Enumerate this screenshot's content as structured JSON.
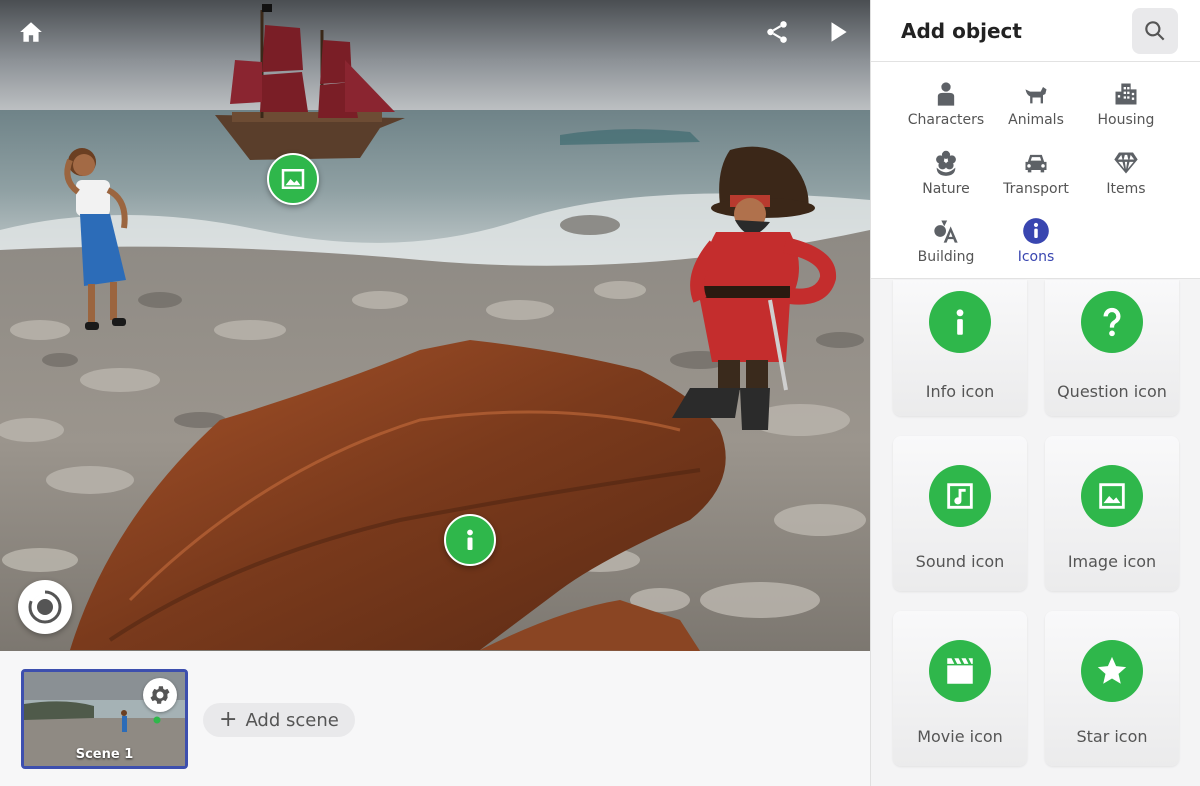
{
  "viewport": {
    "home_icon": "home-icon",
    "share_icon": "share-icon",
    "play_icon": "play-icon",
    "hotspots": [
      {
        "name": "image-hotspot",
        "icon": "image-icon",
        "color": "#2fb74b"
      },
      {
        "name": "info-hotspot",
        "icon": "info-icon",
        "color": "#2fb74b"
      }
    ],
    "gyro_icon": "gyroscope-icon"
  },
  "scene_strip": {
    "scenes": [
      {
        "label": "Scene 1",
        "selected": true
      }
    ],
    "add_scene_label": "Add scene",
    "add_scene_icon": "plus-icon"
  },
  "panel": {
    "title": "Add object",
    "search_icon": "search-icon",
    "categories": [
      {
        "label": "Characters",
        "icon": "person-icon",
        "active": false
      },
      {
        "label": "Animals",
        "icon": "dog-icon",
        "active": false
      },
      {
        "label": "Housing",
        "icon": "building-icon",
        "active": false
      },
      {
        "label": "Nature",
        "icon": "flower-icon",
        "active": false
      },
      {
        "label": "Transport",
        "icon": "car-icon",
        "active": false
      },
      {
        "label": "Items",
        "icon": "diamond-icon",
        "active": false
      },
      {
        "label": "Building",
        "icon": "shapes-icon",
        "active": false
      },
      {
        "label": "Icons",
        "icon": "info-icon",
        "active": true
      }
    ],
    "items": [
      {
        "label": "Info icon",
        "icon": "info-icon"
      },
      {
        "label": "Question icon",
        "icon": "question-icon"
      },
      {
        "label": "Sound icon",
        "icon": "music-note-icon"
      },
      {
        "label": "Image icon",
        "icon": "image-icon"
      },
      {
        "label": "Movie icon",
        "icon": "clapperboard-icon"
      },
      {
        "label": "Star icon",
        "icon": "star-icon"
      }
    ]
  },
  "colors": {
    "accent": "#3946b0",
    "hotspot_green": "#2fb74b",
    "selected_border": "#3d4fae"
  }
}
